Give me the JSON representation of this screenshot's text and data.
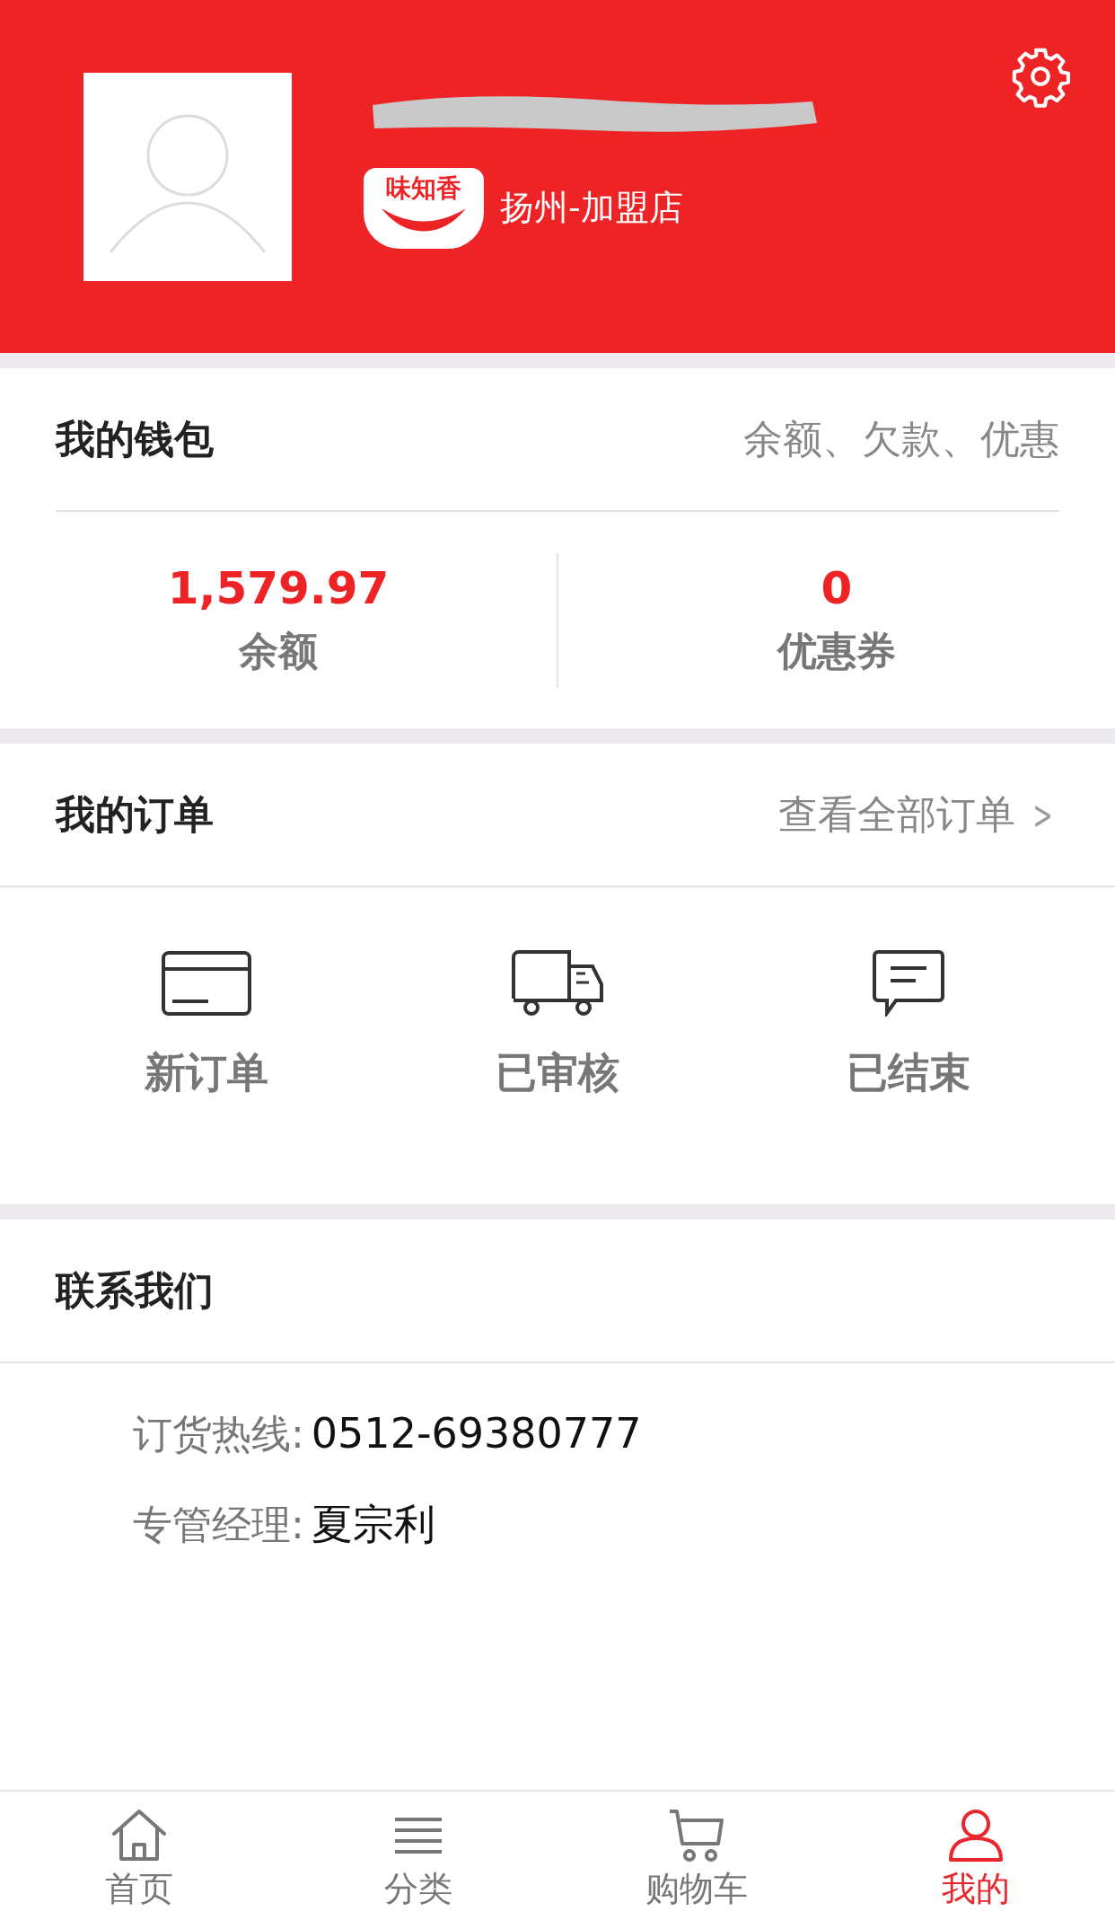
{
  "profile": {
    "logo_text": "味知香",
    "store": "扬州-加盟店"
  },
  "wallet": {
    "title": "我的钱包",
    "hint": "余额、欠款、优惠",
    "stats": [
      {
        "value": "1,579.97",
        "label": "余额"
      },
      {
        "value": "0",
        "label": "优惠券"
      }
    ]
  },
  "orders": {
    "title": "我的订单",
    "link": "查看全部订单",
    "link_icon": ">",
    "items": [
      {
        "kind": "card",
        "label": "新订单"
      },
      {
        "kind": "truck",
        "label": "已审核"
      },
      {
        "kind": "chat",
        "label": "已结束"
      }
    ]
  },
  "contact": {
    "title": "联系我们",
    "rows": [
      {
        "label": "订货热线:",
        "value": "0512-69380777"
      },
      {
        "label": "专管经理:",
        "value": "夏宗利"
      }
    ]
  },
  "tabs": [
    {
      "kind": "home",
      "label": "首页",
      "selected": false
    },
    {
      "kind": "list",
      "label": "分类",
      "selected": false
    },
    {
      "kind": "cart",
      "label": "购物车",
      "selected": false
    },
    {
      "kind": "user",
      "label": "我的",
      "selected": true
    }
  ]
}
